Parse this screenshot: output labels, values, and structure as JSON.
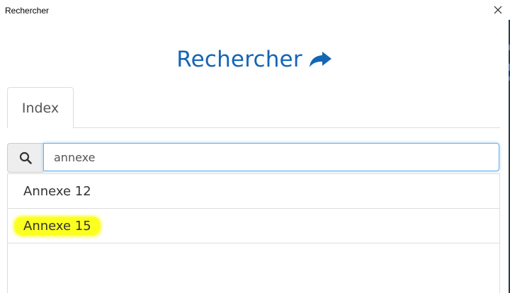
{
  "window": {
    "title": "Rechercher",
    "close_glyph": "✕"
  },
  "heading": {
    "text": "Rechercher",
    "icon": "share-arrow-icon",
    "color": "#1565b5"
  },
  "tabs": [
    {
      "label": "Index",
      "active": true
    }
  ],
  "search": {
    "icon": "search-icon",
    "value": "annexe",
    "placeholder": ""
  },
  "results": [
    {
      "label": "Annexe 12",
      "highlighted": false
    },
    {
      "label": "Annexe 15",
      "highlighted": true
    }
  ],
  "colors": {
    "accent": "#1565b5",
    "highlight": "#fbff1f",
    "input_focus": "#66afe9"
  }
}
